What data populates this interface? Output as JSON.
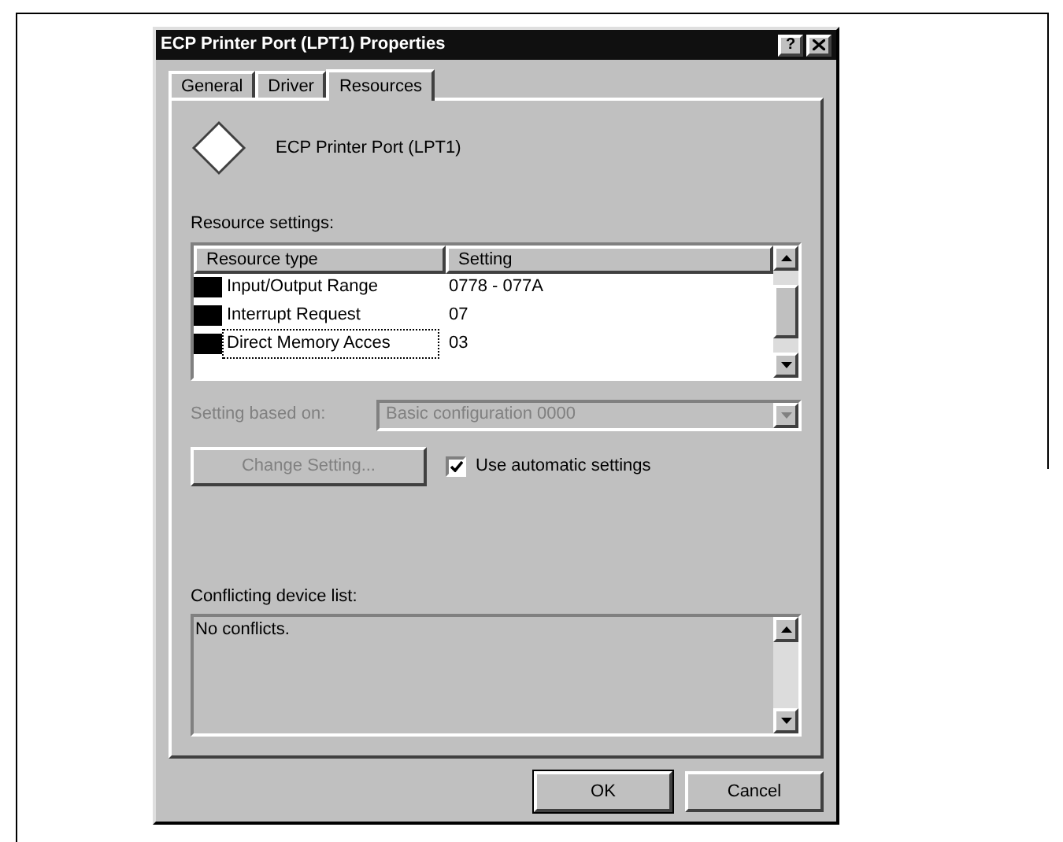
{
  "window": {
    "title": "ECP Printer Port (LPT1) Properties",
    "help_label": "?"
  },
  "tabs": [
    {
      "label": "General",
      "selected": false
    },
    {
      "label": "Driver",
      "selected": false
    },
    {
      "label": "Resources",
      "selected": true
    }
  ],
  "device_name": "ECP Printer Port (LPT1)",
  "resource_settings": {
    "label": "Resource settings:",
    "columns": [
      "Resource type",
      "Setting"
    ],
    "rows": [
      {
        "type": "Input/Output Range",
        "setting": "0778 - 077A",
        "selected": false
      },
      {
        "type": "Interrupt Request",
        "setting": "07",
        "selected": false
      },
      {
        "type": "Direct Memory Acces",
        "setting": "03",
        "selected": true
      }
    ]
  },
  "setting_based_on": {
    "label": "Setting based on:",
    "value": "Basic configuration 0000",
    "disabled": true
  },
  "change_setting": {
    "label": "Change Setting...",
    "disabled": true
  },
  "use_automatic": {
    "label": "Use automatic settings",
    "checked": true
  },
  "conflicts": {
    "label": "Conflicting device list:",
    "text": "No conflicts."
  },
  "buttons": [
    "OK",
    "Cancel"
  ]
}
